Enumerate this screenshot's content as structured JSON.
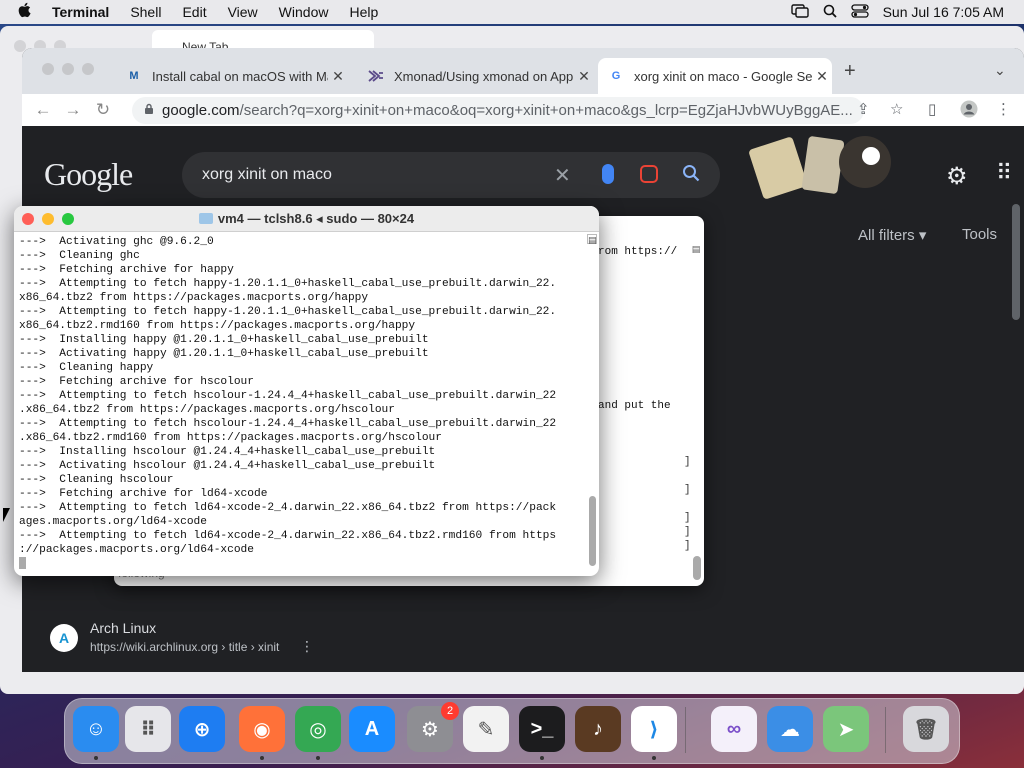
{
  "menubar": {
    "apple_icon": "apple-icon",
    "app_name": "Terminal",
    "items": [
      "Shell",
      "Edit",
      "View",
      "Window",
      "Help"
    ],
    "datetime": "Sun Jul 16  7:05 AM"
  },
  "background_window": {
    "tab_title": "New Tab"
  },
  "chrome": {
    "tabs": [
      {
        "favicon": "M",
        "title": "Install cabal on macOS with Mac",
        "active": false
      },
      {
        "favicon": "xmonad",
        "title": "Xmonad/Using xmonad on Apple",
        "active": false
      },
      {
        "favicon": "G",
        "title": "xorg xinit on maco - Google Se",
        "active": true
      }
    ],
    "new_tab": "+",
    "url_domain": "google.com",
    "url_path": "/search?q=xorg+xinit+on+maco&oq=xorg+xinit+on+maco&gs_lcrp=EgZjaHJvbWUyBggAE...",
    "google": {
      "logo": "Google",
      "query": "xorg xinit on maco",
      "all_filters": "All filters",
      "tools": "Tools",
      "result": {
        "site_name": "Arch Linux",
        "url": "https://wiki.archlinux.org › title › xinit",
        "icon_letter": "A"
      }
    }
  },
  "terminal_back": {
    "visible_text_1": "rom https://",
    "visible_text_2": "and put the",
    "under_text": "following"
  },
  "terminal": {
    "title": "vm4 — tclsh8.6 ◂ sudo — 80×24",
    "lines": [
      "--->  Activating ghc @9.6.2_0",
      "--->  Cleaning ghc",
      "--->  Fetching archive for happy",
      "--->  Attempting to fetch happy-1.20.1.1_0+haskell_cabal_use_prebuilt.darwin_22.",
      "x86_64.tbz2 from https://packages.macports.org/happy",
      "--->  Attempting to fetch happy-1.20.1.1_0+haskell_cabal_use_prebuilt.darwin_22.",
      "x86_64.tbz2.rmd160 from https://packages.macports.org/happy",
      "--->  Installing happy @1.20.1.1_0+haskell_cabal_use_prebuilt",
      "--->  Activating happy @1.20.1.1_0+haskell_cabal_use_prebuilt",
      "--->  Cleaning happy",
      "--->  Fetching archive for hscolour",
      "--->  Attempting to fetch hscolour-1.24.4_4+haskell_cabal_use_prebuilt.darwin_22",
      ".x86_64.tbz2 from https://packages.macports.org/hscolour",
      "--->  Attempting to fetch hscolour-1.24.4_4+haskell_cabal_use_prebuilt.darwin_22",
      ".x86_64.tbz2.rmd160 from https://packages.macports.org/hscolour",
      "--->  Installing hscolour @1.24.4_4+haskell_cabal_use_prebuilt",
      "--->  Activating hscolour @1.24.4_4+haskell_cabal_use_prebuilt",
      "--->  Cleaning hscolour",
      "--->  Fetching archive for ld64-xcode",
      "--->  Attempting to fetch ld64-xcode-2_4.darwin_22.x86_64.tbz2 from https://pack",
      "ages.macports.org/ld64-xcode",
      "--->  Attempting to fetch ld64-xcode-2_4.darwin_22.x86_64.tbz2.rmd160 from https",
      "://packages.macports.org/ld64-xcode"
    ]
  },
  "dock": {
    "apps": [
      {
        "name": "Finder",
        "icon": "finder-icon",
        "color": "#2a8cf0",
        "glyph": "☺",
        "running": true
      },
      {
        "name": "Launchpad",
        "icon": "launchpad-icon",
        "color": "#e6e6ea",
        "glyph": "⠿",
        "running": false
      },
      {
        "name": "Safari",
        "icon": "safari-icon",
        "color": "#1e7df2",
        "glyph": "⊕",
        "running": false
      },
      {
        "name": "Firefox",
        "icon": "firefox-icon",
        "color": "#ff7139",
        "glyph": "◉",
        "running": true
      },
      {
        "name": "Chrome",
        "icon": "chrome-icon",
        "color": "#34a853",
        "glyph": "◎",
        "running": true
      },
      {
        "name": "App Store",
        "icon": "app-store-icon",
        "color": "#1a8cff",
        "glyph": "A",
        "running": false
      },
      {
        "name": "System Settings",
        "icon": "settings-icon",
        "color": "#8e8e93",
        "glyph": "⚙",
        "running": false,
        "badge": "2"
      },
      {
        "name": "TextEdit",
        "icon": "textedit-icon",
        "color": "#f2f2f2",
        "glyph": "✎",
        "running": false
      },
      {
        "name": "Terminal",
        "icon": "terminal-icon",
        "color": "#1c1c1e",
        "glyph": ">_",
        "running": true
      },
      {
        "name": "GarageBand",
        "icon": "garageband-icon",
        "color": "#5a3a22",
        "glyph": "♪",
        "running": false
      },
      {
        "name": "VS Code",
        "icon": "vscode-icon",
        "color": "#ffffff",
        "glyph": "⟩",
        "running": true
      },
      {
        "name": "Visual Studio",
        "icon": "visual-studio-icon",
        "color": "#f4f0fa",
        "glyph": "∞",
        "running": false
      },
      {
        "name": "Weather",
        "icon": "weather-icon",
        "color": "#3b8ee6",
        "glyph": "☁",
        "running": false
      },
      {
        "name": "Maps",
        "icon": "maps-icon",
        "color": "#7bc67b",
        "glyph": "➤",
        "running": false
      },
      {
        "name": "Trash",
        "icon": "trash-icon",
        "color": "#d8d8dc",
        "glyph": "🗑",
        "running": false
      }
    ]
  }
}
